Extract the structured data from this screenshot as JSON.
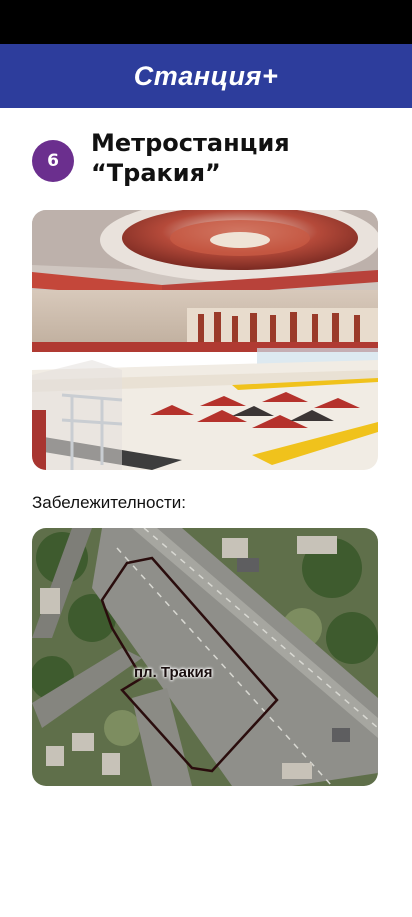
{
  "app": {
    "title": "Станция+"
  },
  "station": {
    "number": "6",
    "title_line1": "Метростанция",
    "title_line2": "“Тракия”"
  },
  "sections": {
    "landmarks_label": "Забележителности:"
  },
  "map": {
    "place_label": "пл. Тракия"
  },
  "colors": {
    "header": "#2d3d9c",
    "badge": "#6b2f8e",
    "boundary": "#2a0d0d"
  }
}
